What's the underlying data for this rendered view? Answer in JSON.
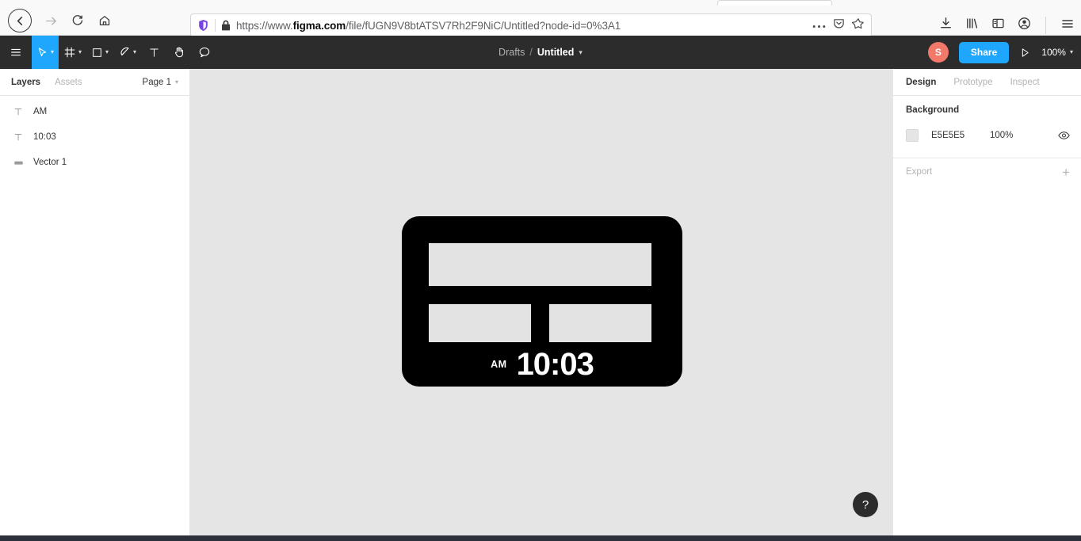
{
  "browser": {
    "url_prefix": "https://www.",
    "url_domain": "figma.com",
    "url_suffix": "/file/fUGN9V8btATSV7Rh2F9NiC/Untitled?node-id=0%3A1",
    "nav": {
      "back": "back-arrow",
      "forward": "forward-arrow",
      "reload": "reload",
      "home": "home"
    },
    "url_icons": {
      "shield": "tracking-protection-shield",
      "lock": "secure-lock",
      "page_actions": "…",
      "pocket": "save-to-pocket",
      "bookmark": "bookmark-star"
    },
    "toolbar_icons": {
      "downloads": "downloads",
      "library": "library",
      "sidebar": "sidebar",
      "account": "account",
      "menu": "hamburger-menu"
    }
  },
  "figma_toolbar": {
    "tools": [
      {
        "name": "main-menu",
        "icon": "hamburger",
        "has_caret": false,
        "active": false
      },
      {
        "name": "move",
        "icon": "cursor",
        "has_caret": true,
        "active": true
      },
      {
        "name": "frame",
        "icon": "frame",
        "has_caret": true,
        "active": false
      },
      {
        "name": "shape",
        "icon": "square",
        "has_caret": true,
        "active": false
      },
      {
        "name": "pen",
        "icon": "pen",
        "has_caret": true,
        "active": false
      },
      {
        "name": "text",
        "icon": "text-T",
        "has_caret": false,
        "active": false
      },
      {
        "name": "hand",
        "icon": "hand",
        "has_caret": false,
        "active": false
      },
      {
        "name": "comment",
        "icon": "comment-bubble",
        "has_caret": false,
        "active": false
      }
    ],
    "breadcrumb_parent": "Drafts",
    "breadcrumb_sep": "/",
    "breadcrumb_file": "Untitled",
    "avatar_initial": "S",
    "avatar_color": "#F2786A",
    "share_label": "Share",
    "accent_color": "#1EA7FD",
    "present_icon": "play-triangle",
    "zoom_level": "100%"
  },
  "left_panel": {
    "tabs": [
      {
        "label": "Layers",
        "active": true
      },
      {
        "label": "Assets",
        "active": false
      }
    ],
    "page_selector": "Page 1",
    "layers": [
      {
        "name": "AM",
        "icon": "text-layer-icon"
      },
      {
        "name": "10:03",
        "icon": "text-layer-icon"
      },
      {
        "name": "Vector 1",
        "icon": "vector-layer-icon"
      }
    ]
  },
  "right_panel": {
    "tabs": [
      {
        "label": "Design",
        "active": true
      },
      {
        "label": "Prototype",
        "active": false
      },
      {
        "label": "Inspect",
        "active": false
      }
    ],
    "background": {
      "title": "Background",
      "hex": "E5E5E5",
      "opacity": "100%",
      "visibility_icon": "eye-icon"
    },
    "export": {
      "label": "Export",
      "add_icon": "+"
    }
  },
  "canvas": {
    "background_color": "#E5E5E5",
    "artwork": {
      "card_color": "#000000",
      "segment_color": "#E3E3E3",
      "ampm": "AM",
      "time": "10:03"
    },
    "help_button": "?"
  }
}
